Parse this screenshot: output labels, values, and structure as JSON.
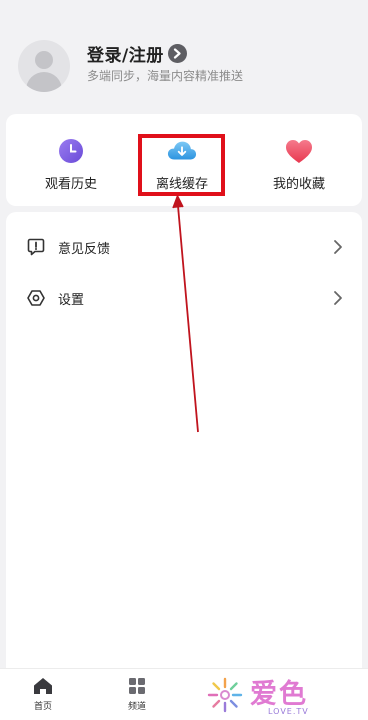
{
  "profile": {
    "title": "登录/注册",
    "subtitle": "多端同步，海量内容精准推送"
  },
  "quick_actions": [
    {
      "label": "观看历史",
      "icon": "clock-icon",
      "color": "#7b5fe0"
    },
    {
      "label": "离线缓存",
      "icon": "cloud-download-icon",
      "color": "#3aa6e8"
    },
    {
      "label": "我的收藏",
      "icon": "heart-icon",
      "color": "#ef4f6a"
    }
  ],
  "menu": [
    {
      "label": "意见反馈",
      "icon": "feedback-icon"
    },
    {
      "label": "设置",
      "icon": "settings-icon"
    }
  ],
  "bottom_nav": [
    {
      "label": "首页",
      "icon": "home-icon"
    },
    {
      "label": "频道",
      "icon": "grid-icon"
    }
  ],
  "watermark": {
    "text": "爱色",
    "sub": "LOVE.TV"
  },
  "colors": {
    "highlight": "#e0101a",
    "arrow": "#c0141e",
    "background": "#f2f2f4"
  }
}
